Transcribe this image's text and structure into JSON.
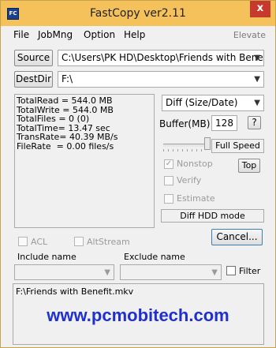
{
  "window": {
    "title": "FastCopy ver2.11",
    "icon_text": "FC",
    "close_glyph": "x"
  },
  "menu": {
    "items": [
      "File",
      "JobMng",
      "Option",
      "Help"
    ],
    "elevate": "Elevate"
  },
  "source": {
    "button_label": "Source",
    "path": "C:\\Users\\PK HD\\Desktop\\Friends with Bene"
  },
  "destdir": {
    "button_label": "DestDir",
    "path": "F:\\"
  },
  "stats": {
    "text": "TotalRead = 544.0 MB\nTotalWrite = 544.0 MB\nTotalFiles = 0 (0)\nTotalTime= 13.47 sec\nTransRate= 40.39 MB/s\nFileRate  = 0.00 files/s"
  },
  "mode": {
    "selected": "Diff (Size/Date)"
  },
  "buffer": {
    "label": "Buffer(MB)",
    "value": "128",
    "help": "?"
  },
  "speed": {
    "label": "Full Speed",
    "level": 1.0
  },
  "options": {
    "nonstop": "Nonstop",
    "verify": "Verify",
    "estimate": "Estimate",
    "top_button": "Top",
    "diff_hdd": "Diff HDD mode",
    "nonstop_checked_glyph": "✓"
  },
  "actions": {
    "cancel": "Cancel..."
  },
  "filters": {
    "acl": "ACL",
    "altstream": "AltStream",
    "include_label": "Include name",
    "exclude_label": "Exclude name",
    "filter_label": "Filter"
  },
  "status": {
    "current_file": "F:\\Friends with Benefit.mkv"
  },
  "watermark": {
    "text": "www.pcmobitech.com"
  },
  "colors": {
    "titlebar": "#f5c15a",
    "close": "#c7392c",
    "watermark": "#1f2fd0"
  }
}
